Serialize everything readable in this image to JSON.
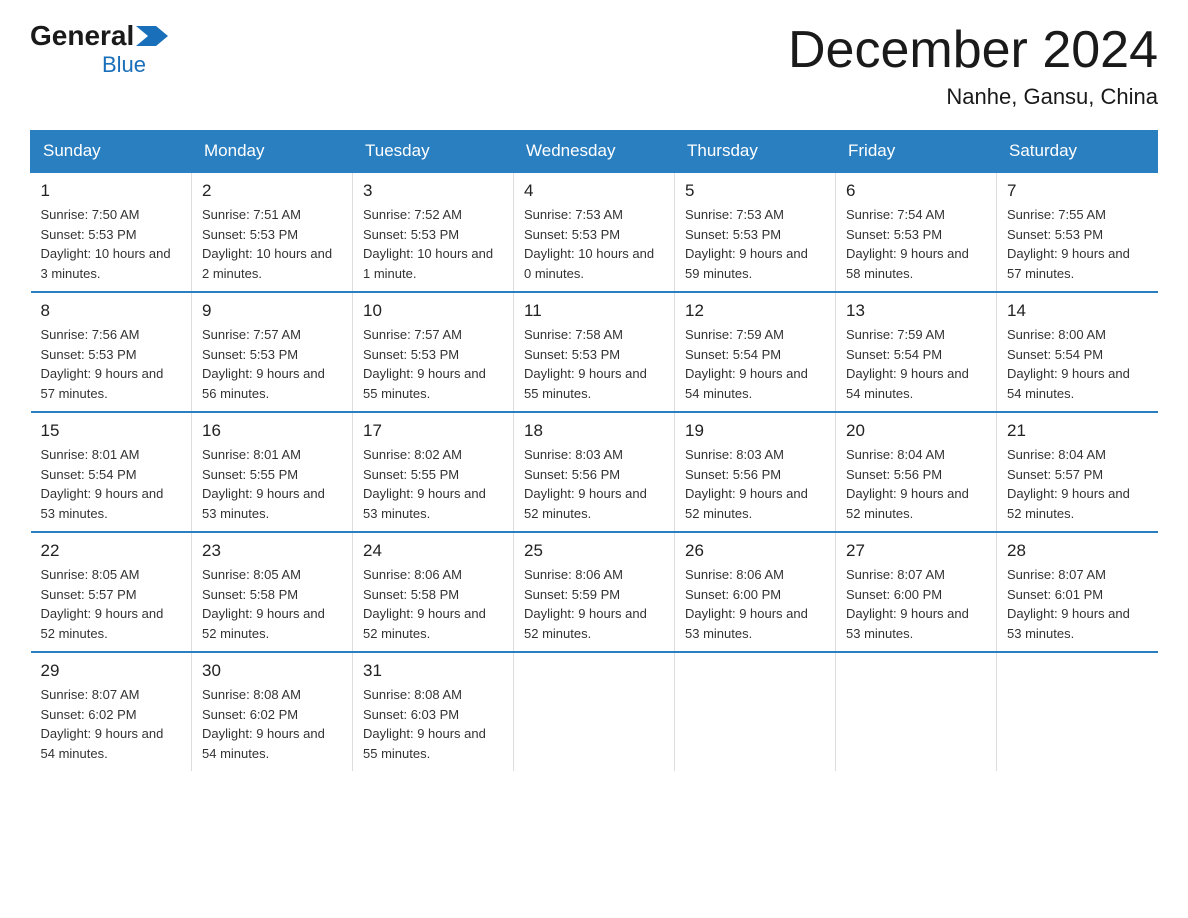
{
  "logo": {
    "general": "General",
    "blue": "Blue"
  },
  "title": {
    "month_year": "December 2024",
    "location": "Nanhe, Gansu, China"
  },
  "calendar": {
    "days_of_week": [
      "Sunday",
      "Monday",
      "Tuesday",
      "Wednesday",
      "Thursday",
      "Friday",
      "Saturday"
    ],
    "weeks": [
      [
        {
          "day": "1",
          "sunrise": "7:50 AM",
          "sunset": "5:53 PM",
          "daylight": "10 hours and 3 minutes."
        },
        {
          "day": "2",
          "sunrise": "7:51 AM",
          "sunset": "5:53 PM",
          "daylight": "10 hours and 2 minutes."
        },
        {
          "day": "3",
          "sunrise": "7:52 AM",
          "sunset": "5:53 PM",
          "daylight": "10 hours and 1 minute."
        },
        {
          "day": "4",
          "sunrise": "7:53 AM",
          "sunset": "5:53 PM",
          "daylight": "10 hours and 0 minutes."
        },
        {
          "day": "5",
          "sunrise": "7:53 AM",
          "sunset": "5:53 PM",
          "daylight": "9 hours and 59 minutes."
        },
        {
          "day": "6",
          "sunrise": "7:54 AM",
          "sunset": "5:53 PM",
          "daylight": "9 hours and 58 minutes."
        },
        {
          "day": "7",
          "sunrise": "7:55 AM",
          "sunset": "5:53 PM",
          "daylight": "9 hours and 57 minutes."
        }
      ],
      [
        {
          "day": "8",
          "sunrise": "7:56 AM",
          "sunset": "5:53 PM",
          "daylight": "9 hours and 57 minutes."
        },
        {
          "day": "9",
          "sunrise": "7:57 AM",
          "sunset": "5:53 PM",
          "daylight": "9 hours and 56 minutes."
        },
        {
          "day": "10",
          "sunrise": "7:57 AM",
          "sunset": "5:53 PM",
          "daylight": "9 hours and 55 minutes."
        },
        {
          "day": "11",
          "sunrise": "7:58 AM",
          "sunset": "5:53 PM",
          "daylight": "9 hours and 55 minutes."
        },
        {
          "day": "12",
          "sunrise": "7:59 AM",
          "sunset": "5:54 PM",
          "daylight": "9 hours and 54 minutes."
        },
        {
          "day": "13",
          "sunrise": "7:59 AM",
          "sunset": "5:54 PM",
          "daylight": "9 hours and 54 minutes."
        },
        {
          "day": "14",
          "sunrise": "8:00 AM",
          "sunset": "5:54 PM",
          "daylight": "9 hours and 54 minutes."
        }
      ],
      [
        {
          "day": "15",
          "sunrise": "8:01 AM",
          "sunset": "5:54 PM",
          "daylight": "9 hours and 53 minutes."
        },
        {
          "day": "16",
          "sunrise": "8:01 AM",
          "sunset": "5:55 PM",
          "daylight": "9 hours and 53 minutes."
        },
        {
          "day": "17",
          "sunrise": "8:02 AM",
          "sunset": "5:55 PM",
          "daylight": "9 hours and 53 minutes."
        },
        {
          "day": "18",
          "sunrise": "8:03 AM",
          "sunset": "5:56 PM",
          "daylight": "9 hours and 52 minutes."
        },
        {
          "day": "19",
          "sunrise": "8:03 AM",
          "sunset": "5:56 PM",
          "daylight": "9 hours and 52 minutes."
        },
        {
          "day": "20",
          "sunrise": "8:04 AM",
          "sunset": "5:56 PM",
          "daylight": "9 hours and 52 minutes."
        },
        {
          "day": "21",
          "sunrise": "8:04 AM",
          "sunset": "5:57 PM",
          "daylight": "9 hours and 52 minutes."
        }
      ],
      [
        {
          "day": "22",
          "sunrise": "8:05 AM",
          "sunset": "5:57 PM",
          "daylight": "9 hours and 52 minutes."
        },
        {
          "day": "23",
          "sunrise": "8:05 AM",
          "sunset": "5:58 PM",
          "daylight": "9 hours and 52 minutes."
        },
        {
          "day": "24",
          "sunrise": "8:06 AM",
          "sunset": "5:58 PM",
          "daylight": "9 hours and 52 minutes."
        },
        {
          "day": "25",
          "sunrise": "8:06 AM",
          "sunset": "5:59 PM",
          "daylight": "9 hours and 52 minutes."
        },
        {
          "day": "26",
          "sunrise": "8:06 AM",
          "sunset": "6:00 PM",
          "daylight": "9 hours and 53 minutes."
        },
        {
          "day": "27",
          "sunrise": "8:07 AM",
          "sunset": "6:00 PM",
          "daylight": "9 hours and 53 minutes."
        },
        {
          "day": "28",
          "sunrise": "8:07 AM",
          "sunset": "6:01 PM",
          "daylight": "9 hours and 53 minutes."
        }
      ],
      [
        {
          "day": "29",
          "sunrise": "8:07 AM",
          "sunset": "6:02 PM",
          "daylight": "9 hours and 54 minutes."
        },
        {
          "day": "30",
          "sunrise": "8:08 AM",
          "sunset": "6:02 PM",
          "daylight": "9 hours and 54 minutes."
        },
        {
          "day": "31",
          "sunrise": "8:08 AM",
          "sunset": "6:03 PM",
          "daylight": "9 hours and 55 minutes."
        },
        null,
        null,
        null,
        null
      ]
    ]
  }
}
